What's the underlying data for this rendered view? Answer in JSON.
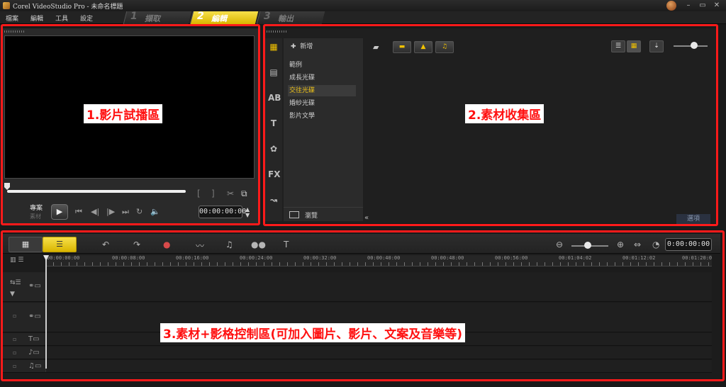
{
  "window": {
    "title": "Corel VideoStudio Pro - 未命名標題"
  },
  "menu": [
    "檔案",
    "編輯",
    "工具",
    "設定"
  ],
  "steps": [
    {
      "num": "1",
      "label": "擷取"
    },
    {
      "num": "2",
      "label": "編輯"
    },
    {
      "num": "3",
      "label": "輸出"
    }
  ],
  "player": {
    "mode_project": "專案",
    "mode_clip": "素材",
    "timecode": "00:00:00:00"
  },
  "library": {
    "add_label": "新增",
    "categories": [
      "範例",
      "成長光碟",
      "交往光碟",
      "婚紗光碟",
      "影片文學"
    ],
    "selected_category": "交往光碟",
    "browse_label": "瀏覽",
    "options_label": "選項"
  },
  "timeline": {
    "timecode": "0:00:00:00",
    "ruler": [
      "00:00:00:00",
      "00:00:08:00",
      "00:00:16:00",
      "00:00:24:00",
      "00:00:32:00",
      "00:00:40:00",
      "00:00:48:00",
      "00:00:56:00",
      "00:01:04:02",
      "00:01:12:02",
      "00:01:20:0"
    ]
  },
  "annotations": {
    "player": "1.影片試播區",
    "library": "2.素材收集區",
    "timeline": "3.素材+影格控制區(可加入圖片、影片、文案及音樂等)"
  },
  "colors": {
    "annotation_red": "#ff1a1a",
    "accent_yellow": "#f2c200"
  }
}
